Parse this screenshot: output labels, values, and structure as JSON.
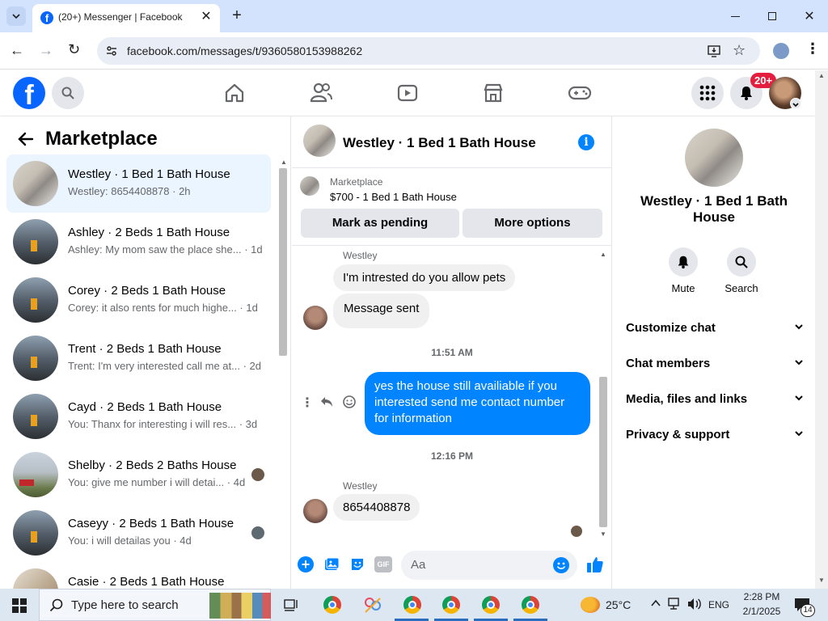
{
  "browser": {
    "tab_title": "(20+) Messenger | Facebook",
    "url": "facebook.com/messages/t/9360580153988262",
    "window_controls": [
      "minimize",
      "restore",
      "close"
    ]
  },
  "fb_header": {
    "notification_badge": "20+"
  },
  "left": {
    "section_title": "Marketplace",
    "conversations": [
      {
        "name": "Westley · 1 Bed 1 Bath House",
        "preview": "Westley: 8654408878 · 2h"
      },
      {
        "name": "Ashley · 2 Beds 1 Bath House",
        "preview": "Ashley: My mom saw the place she... · 1d"
      },
      {
        "name": "Corey · 2 Beds 1 Bath House",
        "preview": "Corey: it also rents for much highe... · 1d"
      },
      {
        "name": "Trent · 2 Beds 1 Bath House",
        "preview": "Trent: I'm very interested call me at... · 2d"
      },
      {
        "name": "Cayd · 2 Beds 1 Bath House",
        "preview": "You: Thanx for interesting i will res... · 3d"
      },
      {
        "name": "Shelby · 2 Beds 2 Baths House",
        "preview": "You: give me number i will detai... · 4d"
      },
      {
        "name": "Caseyy · 2 Beds 1 Bath House",
        "preview": "You: i will detailas you · 4d"
      },
      {
        "name": "Casie · 2 Beds 1 Bath House",
        "preview": ""
      }
    ]
  },
  "chat": {
    "title": "Westley · 1 Bed 1 Bath House",
    "listing_label": "Marketplace",
    "listing_price": "$700 - 1 Bed 1 Bath House",
    "mark_pending_label": "Mark as pending",
    "more_options_label": "More options",
    "sender1": "Westley",
    "msg1": "I'm intrested do you allow pets",
    "msg2": "Message sent",
    "time1": "11:51 AM",
    "msg_out": "yes the house still availiable if you interested send me contact number for information",
    "time2": "12:16 PM",
    "sender2": "Westley",
    "msg3": "8654408878",
    "composer_placeholder": "Aa"
  },
  "right": {
    "title": "Westley · 1 Bed 1 Bath House",
    "mute_label": "Mute",
    "search_label": "Search",
    "sections": [
      "Customize chat",
      "Chat members",
      "Media, files and links",
      "Privacy & support"
    ]
  },
  "taskbar": {
    "search_placeholder": "Type here to search",
    "temperature": "25°C",
    "language": "ENG",
    "time": "2:28 PM",
    "date": "2/1/2025",
    "notif_count": "14"
  },
  "colors": {
    "fb_blue": "#0866ff",
    "messenger_blue": "#0084ff",
    "active_conv": "#ebf5ff"
  }
}
